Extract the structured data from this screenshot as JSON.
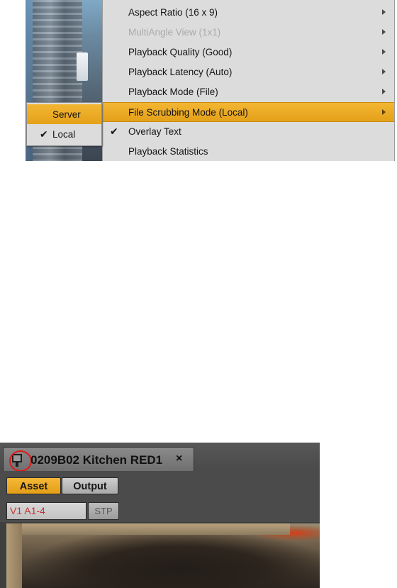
{
  "menu": {
    "items": [
      {
        "label": "Aspect Ratio (16 x 9)",
        "checked": false,
        "disabled": false,
        "highlighted": false,
        "has_submenu": true
      },
      {
        "label": "MultiAngle View (1x1)",
        "checked": false,
        "disabled": true,
        "highlighted": false,
        "has_submenu": true
      },
      {
        "label": "Playback Quality (Good)",
        "checked": false,
        "disabled": false,
        "highlighted": false,
        "has_submenu": true
      },
      {
        "label": "Playback Latency (Auto)",
        "checked": false,
        "disabled": false,
        "highlighted": false,
        "has_submenu": true
      },
      {
        "label": "Playback Mode (File)",
        "checked": false,
        "disabled": false,
        "highlighted": false,
        "has_submenu": true
      },
      {
        "label": "File Scrubbing Mode (Local)",
        "checked": false,
        "disabled": false,
        "highlighted": true,
        "has_submenu": true
      },
      {
        "label": "Overlay Text",
        "checked": true,
        "disabled": false,
        "highlighted": false,
        "has_submenu": false
      },
      {
        "label": "Playback Statistics",
        "checked": false,
        "disabled": false,
        "highlighted": false,
        "has_submenu": false
      }
    ],
    "check_glyph": "✔",
    "highlight_color": "#eaa823"
  },
  "submenu": {
    "items": [
      {
        "label": "Server",
        "checked": false,
        "highlighted": true
      },
      {
        "label": "Local",
        "checked": true,
        "highlighted": false
      }
    ],
    "check_glyph": "✔"
  },
  "panel": {
    "tab": {
      "title": "0209B02 Kitchen RED1",
      "close_glyph": "×",
      "icon": "media-viewer-icon"
    },
    "buttons": {
      "asset_label": "Asset",
      "output_label": "Output"
    },
    "track_field_value": "V1 A1-4",
    "stp_label": "STP",
    "accent_color": "#eaa823",
    "track_text_color": "#c43434"
  }
}
